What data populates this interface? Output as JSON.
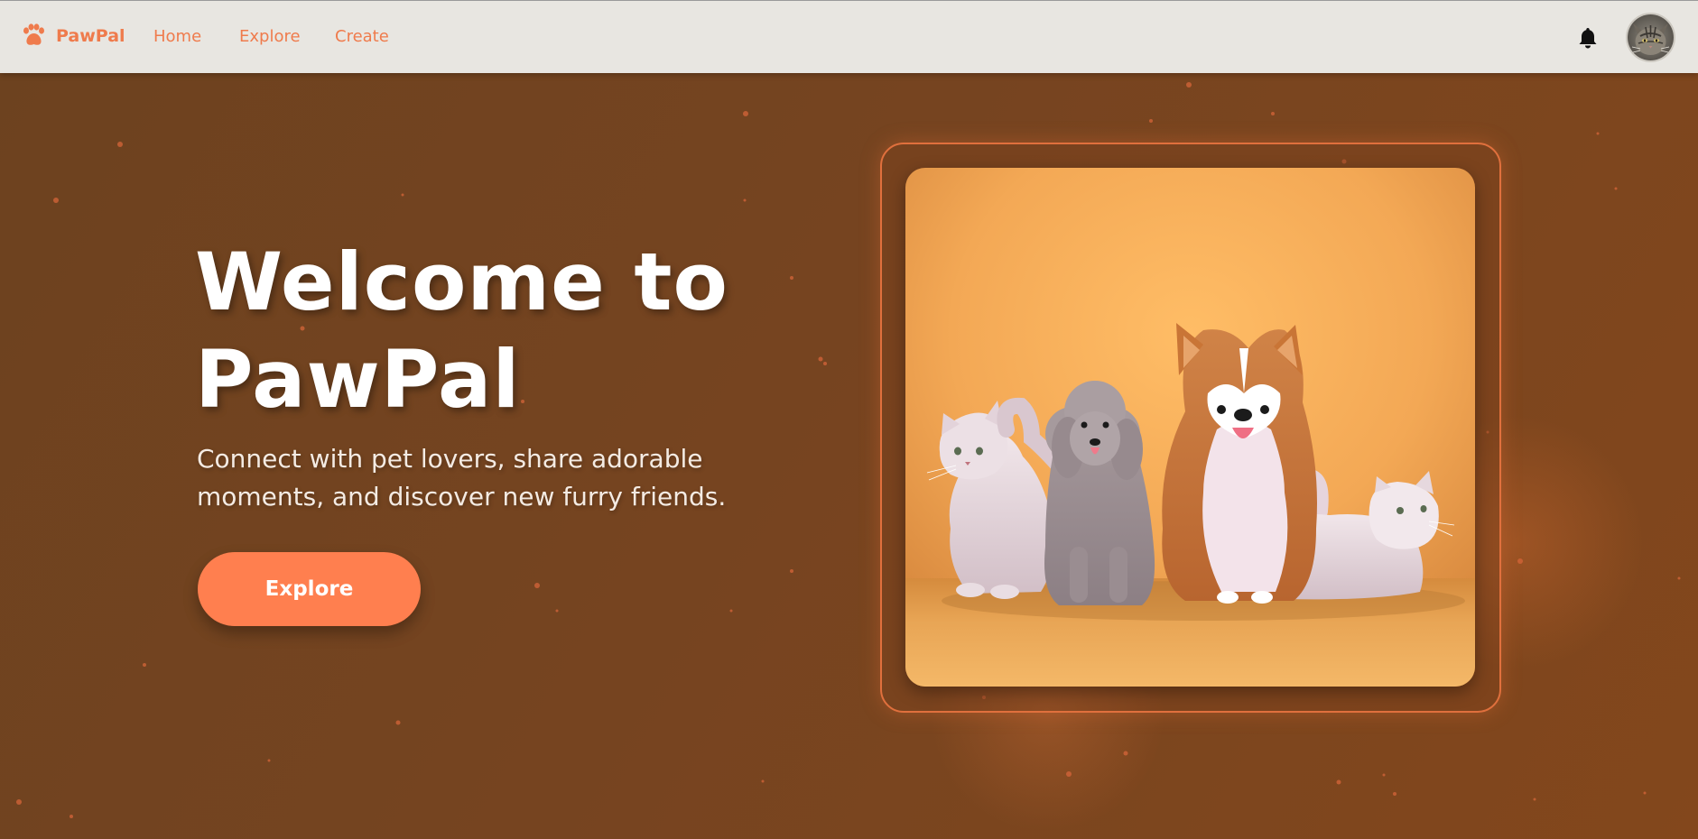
{
  "nav": {
    "brand": "PawPal",
    "brand_icon": "paw-icon",
    "links": [
      {
        "label": "Home"
      },
      {
        "label": "Explore"
      },
      {
        "label": "Create"
      }
    ],
    "notification_icon": "bell-icon",
    "avatar_icon": "cat-avatar"
  },
  "hero": {
    "title_line1": "Welcome to",
    "title_line2": "PawPal",
    "subtitle_line1": "Connect with pet lovers, share adorable",
    "subtitle_line2": "moments, and discover new furry friends.",
    "cta_label": "Explore",
    "illustration": "cats-and-dogs-illustration"
  },
  "colors": {
    "accent": "#ff7f4f",
    "brand_text": "#ef7b4c",
    "navbar_bg": "#e8e6e1",
    "hero_bg": "#764420"
  }
}
